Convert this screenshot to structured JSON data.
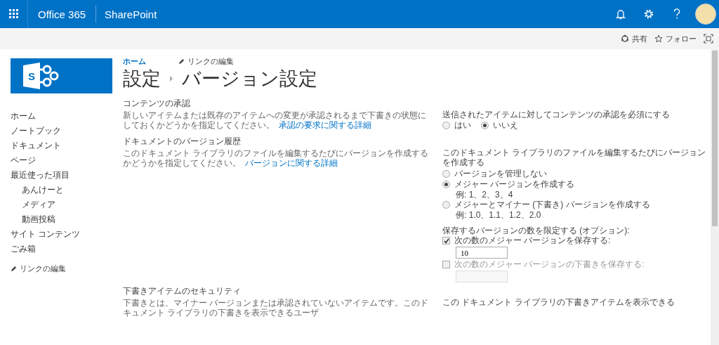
{
  "topbar": {
    "brand": "Office 365",
    "app": "SharePoint"
  },
  "logo": {
    "letter": "S"
  },
  "actions": [
    {
      "kind": "share",
      "label": "共有"
    },
    {
      "kind": "follow",
      "label": "フォロー"
    }
  ],
  "nav": {
    "items": [
      {
        "label": "ホーム"
      },
      {
        "label": "ノートブック"
      },
      {
        "label": "ドキュメント"
      },
      {
        "label": "ページ"
      },
      {
        "label": "最近使った項目",
        "children": [
          {
            "label": "あんけーと"
          },
          {
            "label": "メディア"
          },
          {
            "label": "動画投稿"
          }
        ]
      },
      {
        "label": "サイト コンテンツ"
      },
      {
        "label": "ごみ箱"
      }
    ],
    "edit_links": "リンクの編集"
  },
  "breadcrumb": {
    "home": "ホーム",
    "edit_links": "リンクの編集"
  },
  "title": {
    "parent": "設定",
    "current": "バージョン設定"
  },
  "sections": [
    {
      "heading": "コンテンツの承認",
      "description": "新しいアイテムまたは既存のアイテムへの変更が承認されるまで下書きの状態にしておくかどうかを指定してください。",
      "link": "承認の要求に関する詳細",
      "controls": [
        {
          "kind": "label",
          "text": "送信されたアイテムに対してコンテンツの承認を必須にする"
        },
        {
          "kind": "radio_row",
          "options": [
            {
              "label": "はい",
              "selected": false
            },
            {
              "label": "いいえ",
              "selected": true
            }
          ]
        }
      ]
    },
    {
      "heading": "ドキュメントのバージョン履歴",
      "description": "このドキュメント ライブラリのファイルを編集するたびにバージョンを作成するかどうかを指定してください。",
      "link": "バージョンに関する詳細",
      "controls": [
        {
          "kind": "label",
          "text": "このドキュメント ライブラリのファイルを編集するたびにバージョンを作成する"
        },
        {
          "kind": "radio_list",
          "options": [
            {
              "label": "バージョンを管理しない",
              "selected": false
            },
            {
              "label": "メジャー バージョンを作成する",
              "example": "例: 1、2、3、4",
              "selected": true
            },
            {
              "label": "メジャーとマイナー (下書き) バージョンを作成する",
              "example": "例: 1.0、1.1、1.2、2.0",
              "selected": false
            }
          ]
        },
        {
          "kind": "label",
          "text": "保存するバージョンの数を限定する (オプション):"
        },
        {
          "kind": "checkbox",
          "label": "次の数のメジャー バージョンを保存する:",
          "checked": true,
          "disabled": false,
          "value": "10"
        },
        {
          "kind": "checkbox",
          "label": "次の数のメジャー バージョンの下書きを保存する:",
          "checked": false,
          "disabled": true
        }
      ]
    },
    {
      "heading": "下書きアイテムのセキュリティ",
      "description": "下書きとは、マイナー バージョンまたは承認されていないアイテムです。このドキュメント ライブラリの下書きを表示できるユーザ",
      "controls": [
        {
          "kind": "label",
          "text": "この ドキュメント ライブラリの下書きアイテムを表示できる"
        }
      ]
    }
  ]
}
